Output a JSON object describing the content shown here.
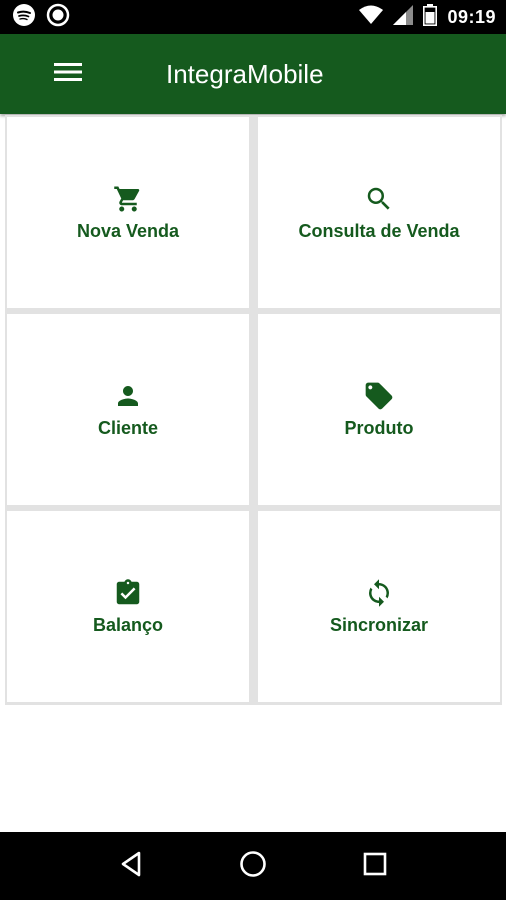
{
  "status_bar": {
    "time": "09:19",
    "icons_left": [
      "spotify-icon",
      "record-icon"
    ],
    "icons_right": [
      "wifi-icon",
      "signal-icon",
      "battery-icon"
    ]
  },
  "app_bar": {
    "title": "IntegraMobile",
    "background": "#155a1e",
    "menu_icon": "hamburger-menu-icon"
  },
  "tiles": [
    {
      "label": "Nova Venda",
      "icon": "shopping-cart-icon"
    },
    {
      "label": "Consulta de Venda",
      "icon": "search-icon"
    },
    {
      "label": "Cliente",
      "icon": "person-icon"
    },
    {
      "label": "Produto",
      "icon": "tag-icon"
    },
    {
      "label": "Balanço",
      "icon": "clipboard-check-icon"
    },
    {
      "label": "Sincronizar",
      "icon": "sync-icon"
    }
  ],
  "colors": {
    "accent": "#155a1e",
    "tile_border": "#e2e2e2"
  },
  "nav_bar": {
    "icons": [
      "back-icon",
      "home-icon",
      "recents-icon"
    ]
  }
}
